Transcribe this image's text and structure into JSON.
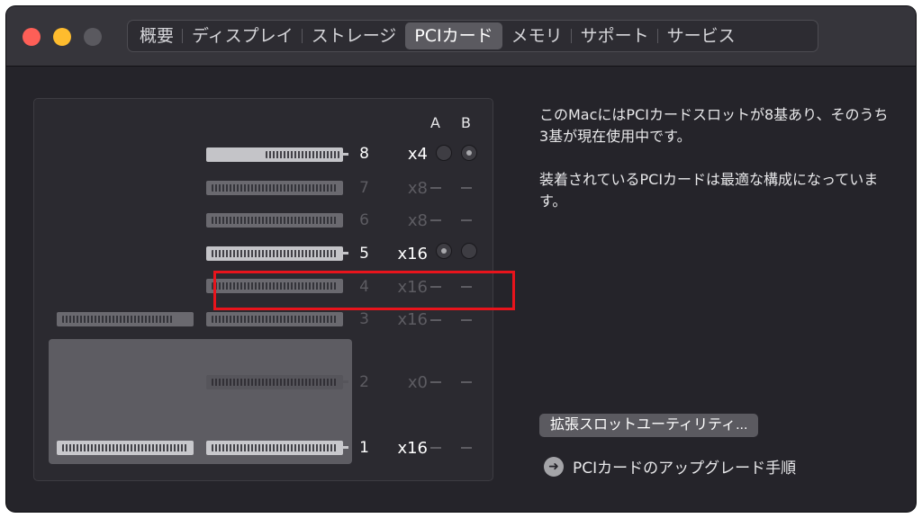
{
  "window": {
    "tabs": [
      {
        "label": "概要"
      },
      {
        "label": "ディスプレイ"
      },
      {
        "label": "ストレージ"
      },
      {
        "label": "PCIカード"
      },
      {
        "label": "メモリ"
      },
      {
        "label": "サポート"
      },
      {
        "label": "サービス"
      }
    ],
    "active_tab": "PCIカード"
  },
  "slots": {
    "col_a": "A",
    "col_b": "B",
    "items": [
      {
        "num": "8",
        "lanes": "x4",
        "occupied": true
      },
      {
        "num": "7",
        "lanes": "x8",
        "occupied": false
      },
      {
        "num": "6",
        "lanes": "x8",
        "occupied": false
      },
      {
        "num": "5",
        "lanes": "x16",
        "occupied": true
      },
      {
        "num": "4",
        "lanes": "x16",
        "occupied": false
      },
      {
        "num": "3",
        "lanes": "x16",
        "occupied": false
      },
      {
        "num": "2",
        "lanes": "x0",
        "occupied": false
      },
      {
        "num": "1",
        "lanes": "x16",
        "occupied": true
      }
    ]
  },
  "info": {
    "line1": "このMacにはPCIカードスロットが8基あり、そのうち3基が現在使用中です。",
    "line2": "装着されているPCIカードは最適な構成になっています。"
  },
  "buttons": {
    "utility": "拡張スロットユーティリティ..."
  },
  "links": {
    "upgrade_guide": "PCIカードのアップグレード手順"
  },
  "colors": {
    "window_bg": "#25242a",
    "highlight": "#e8141c"
  }
}
